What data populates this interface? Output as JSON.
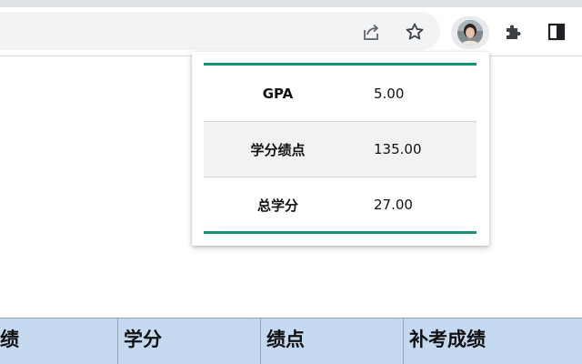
{
  "browser": {
    "toolbar_icons": [
      "share-icon",
      "star-icon",
      "profile-avatar",
      "extensions-puzzle-icon",
      "side-panel-icon"
    ]
  },
  "popup": {
    "rows": [
      {
        "label": "GPA",
        "value": "5.00"
      },
      {
        "label": "学分绩点",
        "value": "135.00"
      },
      {
        "label": "总学分",
        "value": "27.00"
      }
    ],
    "accent_color": "#159478"
  },
  "grade_table": {
    "headers": [
      "绩",
      "学分",
      "绩点",
      "补考成绩"
    ],
    "header_bg": "#c5d9f1"
  }
}
